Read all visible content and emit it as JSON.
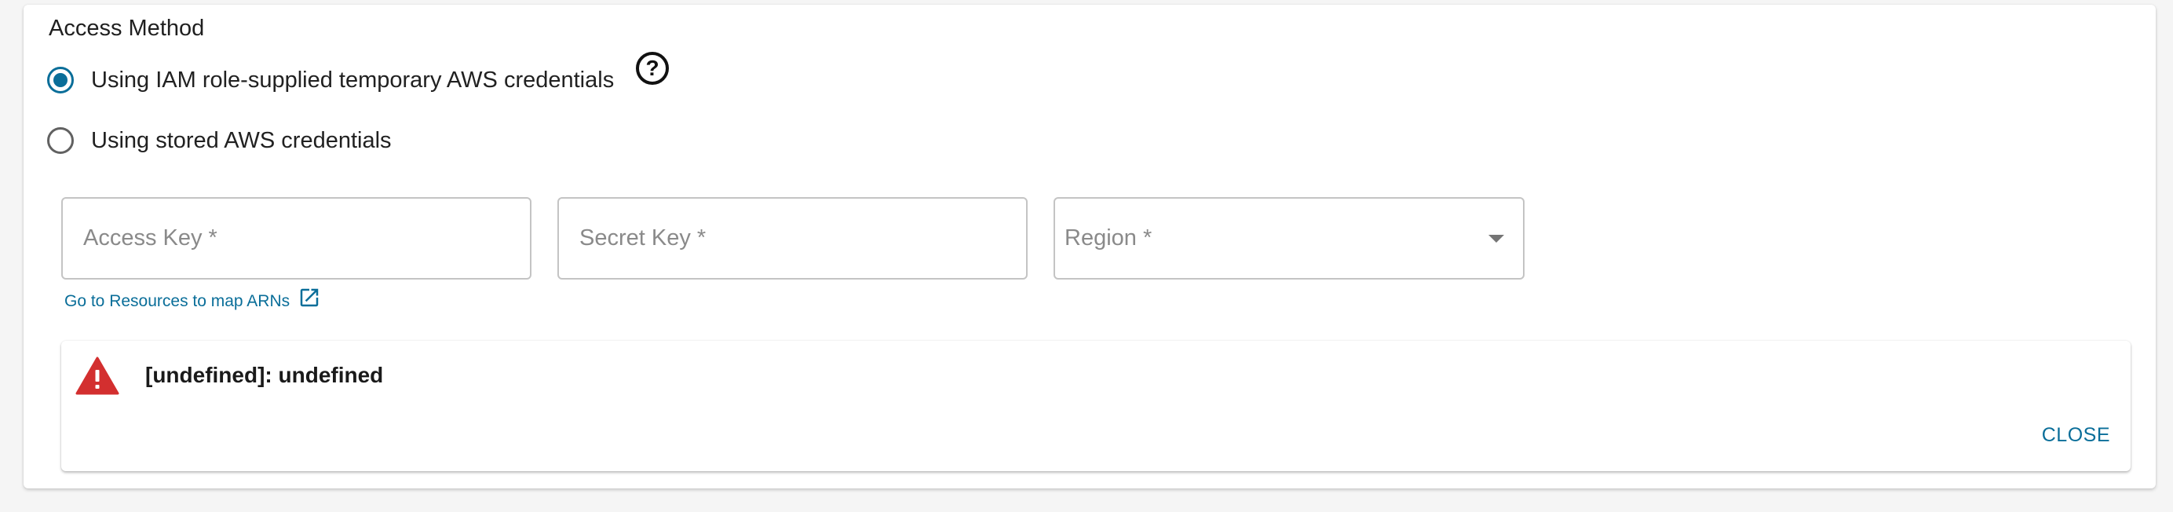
{
  "access_method": {
    "title": "Access Method",
    "options": [
      {
        "label": "Using IAM role-supplied temporary AWS credentials",
        "selected": true
      },
      {
        "label": "Using stored AWS credentials",
        "selected": false
      }
    ],
    "help_icon": "question-circle-icon"
  },
  "fields": {
    "access_key": {
      "placeholder": "Access Key *",
      "value": ""
    },
    "secret_key": {
      "placeholder": "Secret Key *",
      "value": ""
    },
    "region": {
      "placeholder": "Region *",
      "value": ""
    }
  },
  "resources_link": {
    "label": "Go to Resources to map ARNs",
    "icon": "external-link-icon"
  },
  "alert": {
    "icon": "warning-triangle-icon",
    "message": "[undefined]: undefined",
    "close_label": "CLOSE"
  },
  "colors": {
    "accent": "#0a6e99",
    "error": "#d32f2f",
    "background": "#f5f5f5"
  }
}
